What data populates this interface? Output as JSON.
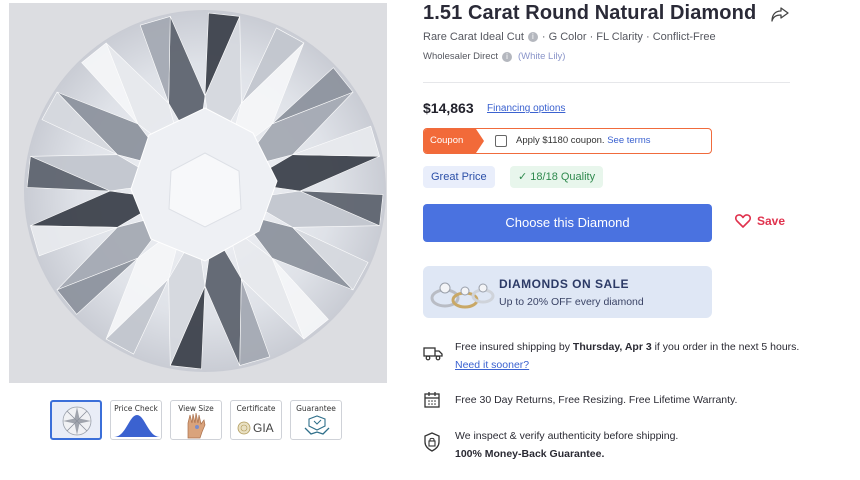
{
  "product": {
    "title": "1.51 Carat Round Natural Diamond",
    "attr_cut": "Rare Carat Ideal Cut",
    "attr_rest": "· G Color · FL Clarity · Conflict-Free",
    "seller_label": "Wholesaler Direct",
    "seller_name": "(White Lily)"
  },
  "thumbnails": [
    {
      "label": "",
      "icon": "diamond-icon"
    },
    {
      "label": "Price Check",
      "icon": "bell-curve-icon"
    },
    {
      "label": "View Size",
      "icon": "hand-icon"
    },
    {
      "label": "Certificate",
      "icon": "seal-icon",
      "text": "GIA"
    },
    {
      "label": "Guarantee",
      "icon": "handshake-icon"
    }
  ],
  "pricing": {
    "price": "$14,863",
    "financing": "Financing options"
  },
  "coupon": {
    "tag": "Coupon",
    "text": "Apply $1180 coupon.",
    "terms": "See terms"
  },
  "badges": {
    "price": "Great Price",
    "quality": "18/18 Quality",
    "check_icon": "✓"
  },
  "actions": {
    "choose": "Choose this Diamond",
    "save": "Save"
  },
  "sale": {
    "title": "DIAMONDS ON SALE",
    "subtitle": "Up to 20% OFF every diamond"
  },
  "features": {
    "shipping_pre": "Free insured shipping by ",
    "shipping_date": "Thursday, Apr 3",
    "shipping_post": " if you order in the next 5 hours. ",
    "shipping_link": "Need it sooner?",
    "returns": "Free 30 Day Returns, Free Resizing. Free Lifetime Warranty.",
    "verify_line1": "We inspect & verify authenticity before shipping.",
    "verify_line2": "100% Money-Back Guarantee."
  },
  "colors": {
    "accent_blue": "#4a72e0",
    "coupon_orange": "#f26a39",
    "save_red": "#e0334e",
    "quality_green": "#2f8a4e"
  }
}
